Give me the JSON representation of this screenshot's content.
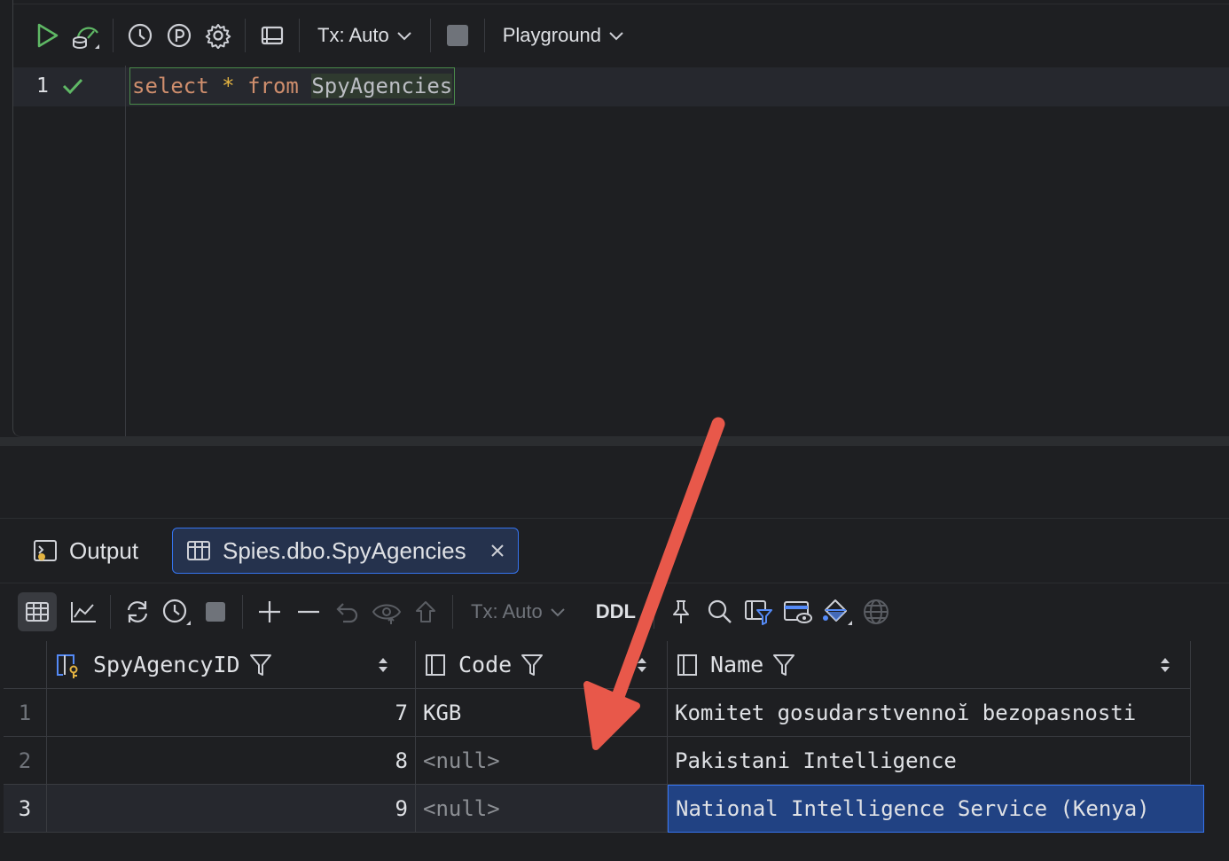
{
  "editor": {
    "toolbar": {
      "tx_label": "Tx: Auto",
      "schema_label": "Playground"
    },
    "lines": [
      {
        "number": "1",
        "status": "check-icon"
      }
    ],
    "query": {
      "kw_select": "select",
      "star": "*",
      "kw_from": "from",
      "table": "SpyAgencies"
    }
  },
  "results": {
    "tabs": [
      {
        "label": "Output",
        "icon": "console-icon"
      },
      {
        "label": "Spies.dbo.SpyAgencies",
        "icon": "table-icon",
        "active": true
      }
    ],
    "toolbar": {
      "tx_label": "Tx: Auto",
      "ddl_label": "DDL"
    },
    "columns": [
      "SpyAgencyID",
      "Code",
      "Name"
    ],
    "rows": [
      {
        "num": "1",
        "id": "7",
        "code": "KGB",
        "name": "Komitet gosudarstvennoĭ bezopasnosti"
      },
      {
        "num": "2",
        "id": "8",
        "code": "<null>",
        "name": "Pakistani Intelligence"
      },
      {
        "num": "3",
        "id": "9",
        "code": "<null>",
        "name": "National Intelligence Service (Kenya)"
      }
    ]
  },
  "colors": {
    "run": "#5fb865",
    "accent": "#3574f0",
    "selection": "#214283",
    "annotation_arrow": "#e8584a"
  }
}
